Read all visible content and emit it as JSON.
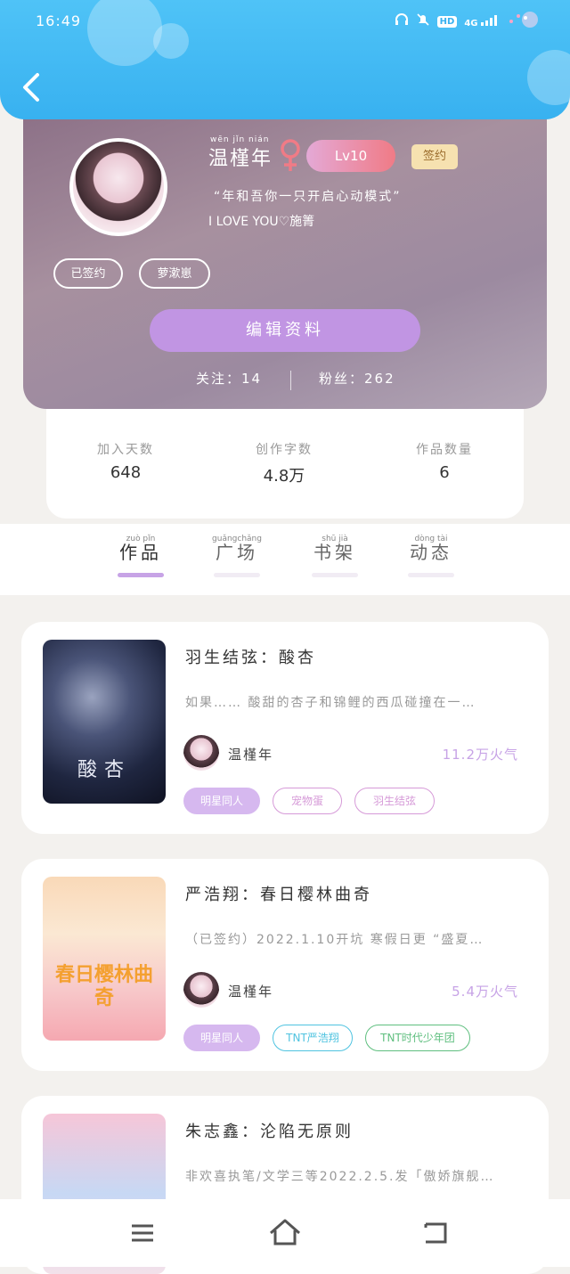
{
  "status_bar": {
    "time": "16:49",
    "network": "4G",
    "hd": "HD"
  },
  "profile": {
    "name": "温槿年",
    "name_pinyin": "wēn  jǐn  nián",
    "level": "Lv10",
    "signed_badge": "签约",
    "quote": "“年和吾你一只开启心动模式”",
    "signature": "I LOVE YOU♡施箐",
    "tags": [
      "已签约",
      "萝漱崽"
    ],
    "edit_label": "编辑资料",
    "following": "关注：14",
    "followers": "粉丝：262"
  },
  "stats": [
    {
      "label": "加入天数",
      "value": "648"
    },
    {
      "label": "创作字数",
      "value": "4.8万"
    },
    {
      "label": "作品数量",
      "value": "6"
    }
  ],
  "tabs": [
    {
      "label": "作品",
      "pinyin": "zuò  pǐn"
    },
    {
      "label": "广场",
      "pinyin": "guǎngchǎng"
    },
    {
      "label": "书架",
      "pinyin": "shū  jià"
    },
    {
      "label": "动态",
      "pinyin": "dòng  tài"
    }
  ],
  "books": [
    {
      "title": "羽生结弦：酸杏",
      "description": "如果…… 酸甜的杏子和锦鲤的西瓜碰撞在一…",
      "cover_text": "酸杏",
      "author": "温槿年",
      "heat": "11.2万火气",
      "chips": [
        "明星同人",
        "宠物蛋",
        "羽生结弦"
      ]
    },
    {
      "title": "严浩翔：春日樱林曲奇",
      "description": "（已签约）2022.1.10开坑 寒假日更 “盛夏…",
      "cover_text": "春日樱林曲奇",
      "author": "温槿年",
      "heat": "5.4万火气",
      "chips": [
        "明星同人",
        "TNT严浩翔",
        "TNT时代少年团"
      ]
    },
    {
      "title": "朱志鑫：沦陷无原则",
      "description": "非欢喜执笔/文学三等2022.2.5.发「傲娇旗舰…",
      "cover_text": "",
      "author": "",
      "heat": "",
      "chips": []
    }
  ],
  "colors": {
    "header": "#38b1f0",
    "accent": "#c195e3",
    "level": "#f07b86"
  },
  "icons": [
    "back-arrow-icon",
    "headphone-icon",
    "mute-bell-icon",
    "signal-icon",
    "menu-icon",
    "home-icon",
    "return-icon"
  ]
}
